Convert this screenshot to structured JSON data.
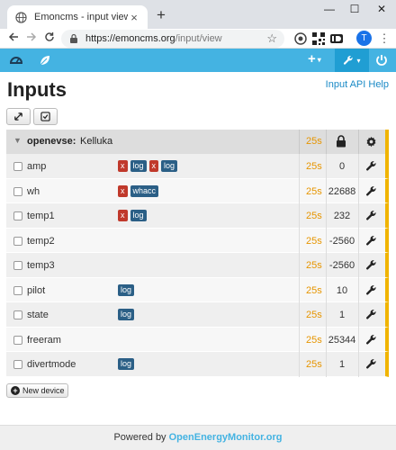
{
  "browser": {
    "tab_title": "Emoncms - input view",
    "tab_close": "×",
    "new_tab": "+",
    "minimize": "—",
    "maximize": "☐",
    "close": "✕",
    "url_host": "https://emoncms.org",
    "url_path": "/input/view",
    "profile_initial": "T"
  },
  "app_nav": {
    "plus": "+",
    "caret": "▾",
    "accent_color": "#44b3e2"
  },
  "page": {
    "title": "Inputs",
    "help_link": "Input API Help"
  },
  "device": {
    "name": "openevse:",
    "description": "Kelluka",
    "time": "25s"
  },
  "inputs": [
    {
      "name": "amp",
      "processes": [
        {
          "type": "x",
          "label": "x"
        },
        {
          "type": "log",
          "label": "log"
        },
        {
          "type": "x",
          "label": "x"
        },
        {
          "type": "log",
          "label": "log"
        }
      ],
      "time": "25s",
      "value": "0"
    },
    {
      "name": "wh",
      "processes": [
        {
          "type": "x",
          "label": "x"
        },
        {
          "type": "whacc",
          "label": "whacc"
        }
      ],
      "time": "25s",
      "value": "22688"
    },
    {
      "name": "temp1",
      "processes": [
        {
          "type": "x",
          "label": "x"
        },
        {
          "type": "log",
          "label": "log"
        }
      ],
      "time": "25s",
      "value": "232"
    },
    {
      "name": "temp2",
      "processes": [],
      "time": "25s",
      "value": "-2560"
    },
    {
      "name": "temp3",
      "processes": [],
      "time": "25s",
      "value": "-2560"
    },
    {
      "name": "pilot",
      "processes": [
        {
          "type": "log",
          "label": "log"
        }
      ],
      "time": "25s",
      "value": "10"
    },
    {
      "name": "state",
      "processes": [
        {
          "type": "log",
          "label": "log"
        }
      ],
      "time": "25s",
      "value": "1"
    },
    {
      "name": "freeram",
      "processes": [],
      "time": "25s",
      "value": "25344"
    },
    {
      "name": "divertmode",
      "processes": [
        {
          "type": "log",
          "label": "log"
        }
      ],
      "time": "25s",
      "value": "1"
    }
  ],
  "new_device_label": "New device",
  "footer": {
    "prefix": "Powered by",
    "brand": "OpenEnergyMonitor.org"
  }
}
